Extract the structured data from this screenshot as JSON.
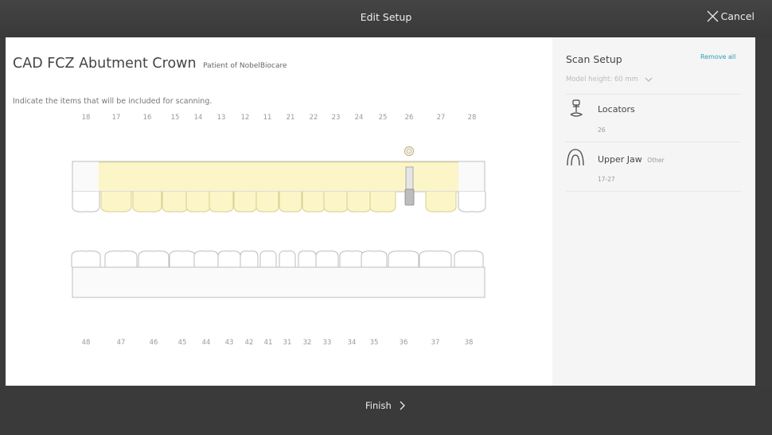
{
  "header": {
    "title": "Edit Setup",
    "cancel_label": "Cancel"
  },
  "main": {
    "title": "CAD FCZ Abutment Crown",
    "patient": "Patient of NobelBiocare",
    "instruction": "Indicate the items that will be included for scanning."
  },
  "teeth": {
    "upper": [
      "18",
      "17",
      "16",
      "15",
      "14",
      "13",
      "12",
      "11",
      "21",
      "22",
      "23",
      "24",
      "25",
      "26",
      "27",
      "28"
    ],
    "lower": [
      "48",
      "47",
      "46",
      "45",
      "44",
      "43",
      "42",
      "41",
      "31",
      "32",
      "33",
      "34",
      "35",
      "36",
      "37",
      "38"
    ],
    "selected_range": "17-27",
    "locator_tooth": "26"
  },
  "scan_setup": {
    "title": "Scan Setup",
    "remove_all": "Remove all",
    "model_height": "Model height: 60 mm",
    "items": [
      {
        "icon": "locator-icon",
        "title": "Locators",
        "tag": "",
        "sub": "26"
      },
      {
        "icon": "upper-jaw-icon",
        "title": "Upper Jaw",
        "tag": "Other",
        "sub": "17-27"
      }
    ]
  },
  "footer": {
    "finish_label": "Finish"
  },
  "colors": {
    "highlight": "#fbf5c8",
    "link": "#2a9db5",
    "bar": "#3b3b3b"
  }
}
